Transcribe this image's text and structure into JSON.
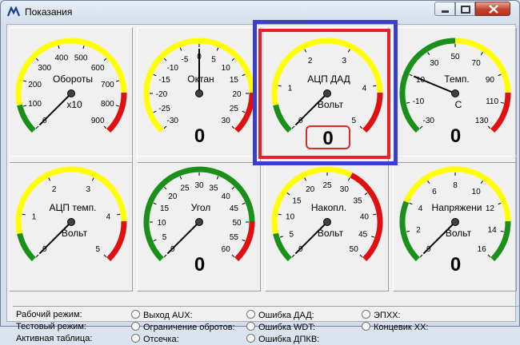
{
  "window": {
    "title": "Показания"
  },
  "gauges": [
    {
      "name": "Обороты",
      "unit": "x10",
      "value": "0",
      "show_value": false,
      "ticks": [
        "0",
        "100",
        "200",
        "300",
        "400",
        "500",
        "600",
        "700",
        "800",
        "900"
      ],
      "needle": 0.0
    },
    {
      "name": "Октан",
      "unit": "",
      "value": "0",
      "show_value": true,
      "ticks": [
        "-30",
        "-25",
        "-20",
        "-15",
        "-10",
        "-5",
        "0",
        "5",
        "10",
        "15",
        "20",
        "25",
        "30"
      ],
      "needle": 0.5
    },
    {
      "name": "АЦП ДАД",
      "unit": "Вольт",
      "value": "0",
      "show_value": true,
      "ticks": [
        "0",
        "1",
        "2",
        "3",
        "4",
        "5"
      ],
      "needle": 0.0
    },
    {
      "name": "Темп.",
      "unit": "С",
      "value": "0",
      "show_value": true,
      "ticks": [
        "-30",
        "-10",
        "10",
        "30",
        "50",
        "70",
        "90",
        "110",
        "130"
      ],
      "needle": 0.25
    },
    {
      "name": "АЦП темп.",
      "unit": "Вольт",
      "value": "",
      "show_value": false,
      "ticks": [
        "0",
        "1",
        "2",
        "3",
        "4",
        "5"
      ],
      "needle": 0.0
    },
    {
      "name": "Угол",
      "unit": "",
      "value": "0",
      "show_value": true,
      "ticks": [
        "0",
        "5",
        "10",
        "15",
        "20",
        "25",
        "30",
        "35",
        "40",
        "45",
        "50",
        "55",
        "60"
      ],
      "needle": 0.0
    },
    {
      "name": "Накопл.",
      "unit": "Вольт",
      "value": "",
      "show_value": false,
      "ticks": [
        "0",
        "5",
        "10",
        "15",
        "20",
        "25",
        "30",
        "35",
        "40",
        "45",
        "50"
      ],
      "needle": 0.0
    },
    {
      "name": "Напряжени",
      "unit": "Вольт",
      "value": "0",
      "show_value": true,
      "ticks": [
        "0",
        "2",
        "4",
        "6",
        "8",
        "10",
        "12",
        "14",
        "16"
      ],
      "needle": 0.0
    }
  ],
  "status": {
    "labels": [
      "Рабочий режим:",
      "Тестовый режим:",
      "Активная таблица:"
    ],
    "indicators_col1": [
      "Выход AUX:",
      "Ограничение обротов:",
      "Отсечка:"
    ],
    "indicators_col2": [
      "Ошибка ДАД:",
      "Ошибка WDT:",
      "Ошибка ДПКВ:"
    ],
    "indicators_col3": [
      "ЭПХХ:",
      "Концевик ХХ:"
    ]
  },
  "colors": {
    "green": "#1a8f1a",
    "yellow": "#ffff00",
    "red": "#e01010",
    "selection_red": "#e8202a",
    "selection_blue": "#3b3fc6"
  }
}
